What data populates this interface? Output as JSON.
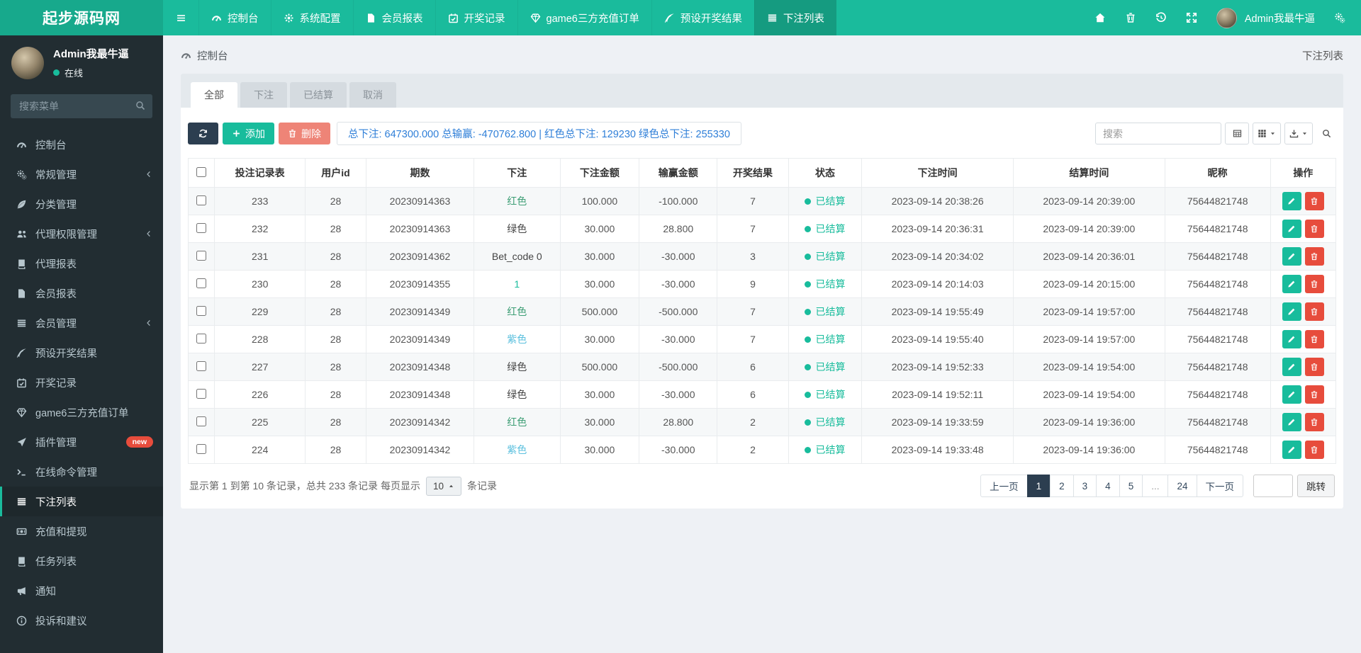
{
  "brand": {
    "logo_text": "起步源码网"
  },
  "topnav": {
    "menu_toggle_icon": "menu",
    "items": [
      {
        "label": "控制台",
        "icon": "gauge",
        "active": false
      },
      {
        "label": "系统配置",
        "icon": "gear",
        "active": false
      },
      {
        "label": "会员报表",
        "icon": "file",
        "active": false
      },
      {
        "label": "开奖记录",
        "icon": "calendar",
        "active": false
      },
      {
        "label": "game6三方充值订单",
        "icon": "gem",
        "active": false
      },
      {
        "label": "预设开奖结果",
        "icon": "quill",
        "active": false
      },
      {
        "label": "下注列表",
        "icon": "list",
        "active": true
      }
    ],
    "right_icons": [
      "home",
      "trash",
      "history",
      "fullscreen"
    ],
    "user_name": "Admin我最牛逼",
    "settings_icon": "gears"
  },
  "sidebar": {
    "user": {
      "name": "Admin我最牛逼",
      "status": "在线",
      "status_dot_color": "#18BC9C"
    },
    "search_placeholder": "搜索菜单",
    "items": [
      {
        "label": "控制台",
        "icon": "gauge"
      },
      {
        "label": "常规管理",
        "icon": "gears",
        "arrow": true
      },
      {
        "label": "分类管理",
        "icon": "leaf"
      },
      {
        "label": "代理权限管理",
        "icon": "users",
        "arrow": true
      },
      {
        "label": "代理报表",
        "icon": "book"
      },
      {
        "label": "会员报表",
        "icon": "file"
      },
      {
        "label": "会员管理",
        "icon": "list",
        "arrow": true
      },
      {
        "label": "预设开奖结果",
        "icon": "quill"
      },
      {
        "label": "开奖记录",
        "icon": "calendar"
      },
      {
        "label": "game6三方充值订单",
        "icon": "gem"
      },
      {
        "label": "插件管理",
        "icon": "rocket",
        "badge": "new"
      },
      {
        "label": "在线命令管理",
        "icon": "terminal"
      },
      {
        "label": "下注列表",
        "icon": "list",
        "active": true
      },
      {
        "label": "充值和提现",
        "icon": "money"
      },
      {
        "label": "任务列表",
        "icon": "book"
      },
      {
        "label": "通知",
        "icon": "megaphone"
      },
      {
        "label": "投诉和建议",
        "icon": "info"
      }
    ]
  },
  "breadcrumb": {
    "left": "控制台",
    "left_icon": "gauge",
    "right": "下注列表"
  },
  "tabs": [
    {
      "label": "全部",
      "active": true
    },
    {
      "label": "下注",
      "active": false
    },
    {
      "label": "已结算",
      "active": false
    },
    {
      "label": "取消",
      "active": false
    }
  ],
  "toolbar": {
    "refresh_icon": "refresh",
    "add_label": "添加",
    "delete_label": "删除",
    "summary": "总下注: 647300.000 总输赢: -470762.800 | 红色总下注: 129230 绿色总下注: 255330",
    "search_placeholder": "搜索",
    "view_icons": [
      "tableview",
      "grid",
      "download",
      "search"
    ]
  },
  "table": {
    "columns": [
      "投注记录表",
      "用户id",
      "期数",
      "下注",
      "下注金额",
      "输赢金额",
      "开奖结果",
      "状态",
      "下注时间",
      "结算时间",
      "昵称",
      "操作"
    ],
    "status_color": "#18BC9C",
    "rows": [
      {
        "record": "233",
        "user_id": "28",
        "period": "20230914363",
        "bet": "红色",
        "bet_color": "#3D9E75",
        "bet_amount": "100.000",
        "win_loss": "-100.000",
        "result": "7",
        "status": "已结算",
        "bet_time": "2023-09-14 20:38:26",
        "settle_time": "2023-09-14 20:39:00",
        "nickname": "75644821748"
      },
      {
        "record": "232",
        "user_id": "28",
        "period": "20230914363",
        "bet": "绿色",
        "bet_color": "#444444",
        "bet_amount": "30.000",
        "win_loss": "28.800",
        "result": "7",
        "status": "已结算",
        "bet_time": "2023-09-14 20:36:31",
        "settle_time": "2023-09-14 20:39:00",
        "nickname": "75644821748"
      },
      {
        "record": "231",
        "user_id": "28",
        "period": "20230914362",
        "bet": "Bet_code 0",
        "bet_color": "#444444",
        "bet_amount": "30.000",
        "win_loss": "-30.000",
        "result": "3",
        "status": "已结算",
        "bet_time": "2023-09-14 20:34:02",
        "settle_time": "2023-09-14 20:36:01",
        "nickname": "75644821748"
      },
      {
        "record": "230",
        "user_id": "28",
        "period": "20230914355",
        "bet": "1",
        "bet_color": "#18BC9C",
        "bet_amount": "30.000",
        "win_loss": "-30.000",
        "result": "9",
        "status": "已结算",
        "bet_time": "2023-09-14 20:14:03",
        "settle_time": "2023-09-14 20:15:00",
        "nickname": "75644821748"
      },
      {
        "record": "229",
        "user_id": "28",
        "period": "20230914349",
        "bet": "红色",
        "bet_color": "#3D9E75",
        "bet_amount": "500.000",
        "win_loss": "-500.000",
        "result": "7",
        "status": "已结算",
        "bet_time": "2023-09-14 19:55:49",
        "settle_time": "2023-09-14 19:57:00",
        "nickname": "75644821748"
      },
      {
        "record": "228",
        "user_id": "28",
        "period": "20230914349",
        "bet": "紫色",
        "bet_color": "#5BC0DE",
        "bet_amount": "30.000",
        "win_loss": "-30.000",
        "result": "7",
        "status": "已结算",
        "bet_time": "2023-09-14 19:55:40",
        "settle_time": "2023-09-14 19:57:00",
        "nickname": "75644821748"
      },
      {
        "record": "227",
        "user_id": "28",
        "period": "20230914348",
        "bet": "绿色",
        "bet_color": "#444444",
        "bet_amount": "500.000",
        "win_loss": "-500.000",
        "result": "6",
        "status": "已结算",
        "bet_time": "2023-09-14 19:52:33",
        "settle_time": "2023-09-14 19:54:00",
        "nickname": "75644821748"
      },
      {
        "record": "226",
        "user_id": "28",
        "period": "20230914348",
        "bet": "绿色",
        "bet_color": "#444444",
        "bet_amount": "30.000",
        "win_loss": "-30.000",
        "result": "6",
        "status": "已结算",
        "bet_time": "2023-09-14 19:52:11",
        "settle_time": "2023-09-14 19:54:00",
        "nickname": "75644821748"
      },
      {
        "record": "225",
        "user_id": "28",
        "period": "20230914342",
        "bet": "红色",
        "bet_color": "#3D9E75",
        "bet_amount": "30.000",
        "win_loss": "28.800",
        "result": "2",
        "status": "已结算",
        "bet_time": "2023-09-14 19:33:59",
        "settle_time": "2023-09-14 19:36:00",
        "nickname": "75644821748"
      },
      {
        "record": "224",
        "user_id": "28",
        "period": "20230914342",
        "bet": "紫色",
        "bet_color": "#5BC0DE",
        "bet_amount": "30.000",
        "win_loss": "-30.000",
        "result": "2",
        "status": "已结算",
        "bet_time": "2023-09-14 19:33:48",
        "settle_time": "2023-09-14 19:36:00",
        "nickname": "75644821748"
      }
    ]
  },
  "footer": {
    "info_prefix": "显示第 1 到第 10 条记录，总共 233 条记录 每页显示",
    "per_page": "10",
    "info_suffix": "条记录",
    "pagination": {
      "prev": "上一页",
      "pages": [
        "1",
        "2",
        "3",
        "4",
        "5",
        "...",
        "24"
      ],
      "active_page": "1",
      "next": "下一页",
      "jump_label": "跳转"
    }
  },
  "colors": {
    "navbar": "#1ABB9C",
    "navbar_active": "#159B80",
    "sidebar": "#222D32",
    "accent": "#18BC9C",
    "primary_dark": "#2C3E50",
    "danger": "#E74C3C",
    "danger_light": "#EE8477",
    "summary_blue": "#2F7FD8",
    "badge_new": "#E74C3C"
  }
}
